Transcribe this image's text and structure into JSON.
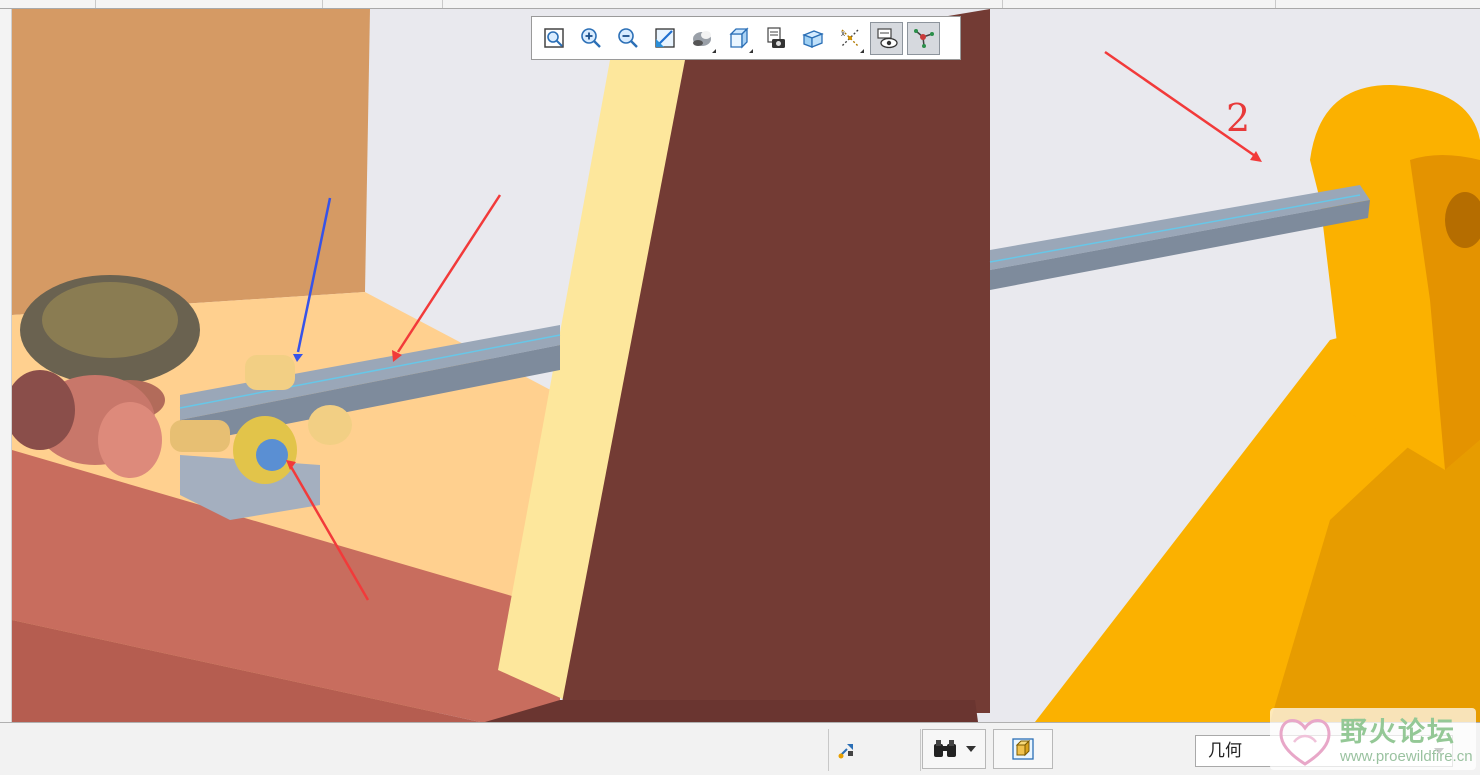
{
  "viewport": {
    "annotation_label": "2",
    "colors": {
      "background": "#e9e9ee",
      "floor": "#ffd08f",
      "back_wall": "#d59a64",
      "front_wall": "#c86d5e",
      "pillar": "#733b34",
      "pillar_highlight": "#fde79c",
      "rack": "#8f9db0",
      "bracket": "#fbb100",
      "arrow_red": "#f23a3a",
      "arrow_blue": "#3753e8"
    }
  },
  "view_toolbar": {
    "buttons": [
      {
        "icon": "refit-icon",
        "active": false,
        "flyout": false
      },
      {
        "icon": "zoom-in-icon",
        "active": false,
        "flyout": false
      },
      {
        "icon": "zoom-out-icon",
        "active": false,
        "flyout": false
      },
      {
        "icon": "repaint-icon",
        "active": false,
        "flyout": false
      },
      {
        "icon": "perspective-icon",
        "active": false,
        "flyout": true
      },
      {
        "icon": "display-style-icon",
        "active": false,
        "flyout": true
      },
      {
        "icon": "saved-views-icon",
        "active": false,
        "flyout": false
      },
      {
        "icon": "section-icon",
        "active": false,
        "flyout": false
      },
      {
        "icon": "datum-display-icon",
        "active": false,
        "flyout": true
      },
      {
        "icon": "annotation-display-icon",
        "active": true,
        "flyout": false
      },
      {
        "icon": "spin-center-icon",
        "active": true,
        "flyout": false
      }
    ]
  },
  "status_bar": {
    "filter_value": "几何",
    "icons": [
      "regenerate-icon",
      "find-icon",
      "selection-box-icon"
    ]
  },
  "watermark": {
    "title": "野火论坛",
    "url": "www.proewildfire.cn"
  }
}
